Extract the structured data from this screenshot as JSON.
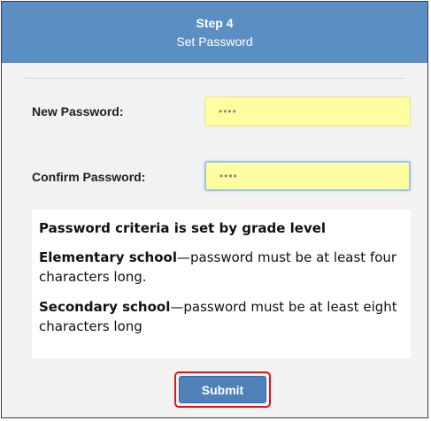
{
  "header": {
    "step": "Step 4",
    "subtitle": "Set Password"
  },
  "form": {
    "new_password": {
      "label": "New Password:",
      "value": "••••"
    },
    "confirm_password": {
      "label": "Confirm Password:",
      "value": "••••"
    }
  },
  "criteria": {
    "heading": "Password criteria is set by grade level",
    "items": [
      {
        "bold": "Elementary school",
        "text": "—password must be at least four characters long."
      },
      {
        "bold": "Secondary school",
        "text": "—password must be at least eight characters long"
      }
    ]
  },
  "submit_label": "Submit",
  "colors": {
    "header_bg": "#5b8fc4",
    "input_bg": "#fefea0",
    "button_bg": "#4f81b8",
    "highlight_outline": "#e0131b"
  }
}
